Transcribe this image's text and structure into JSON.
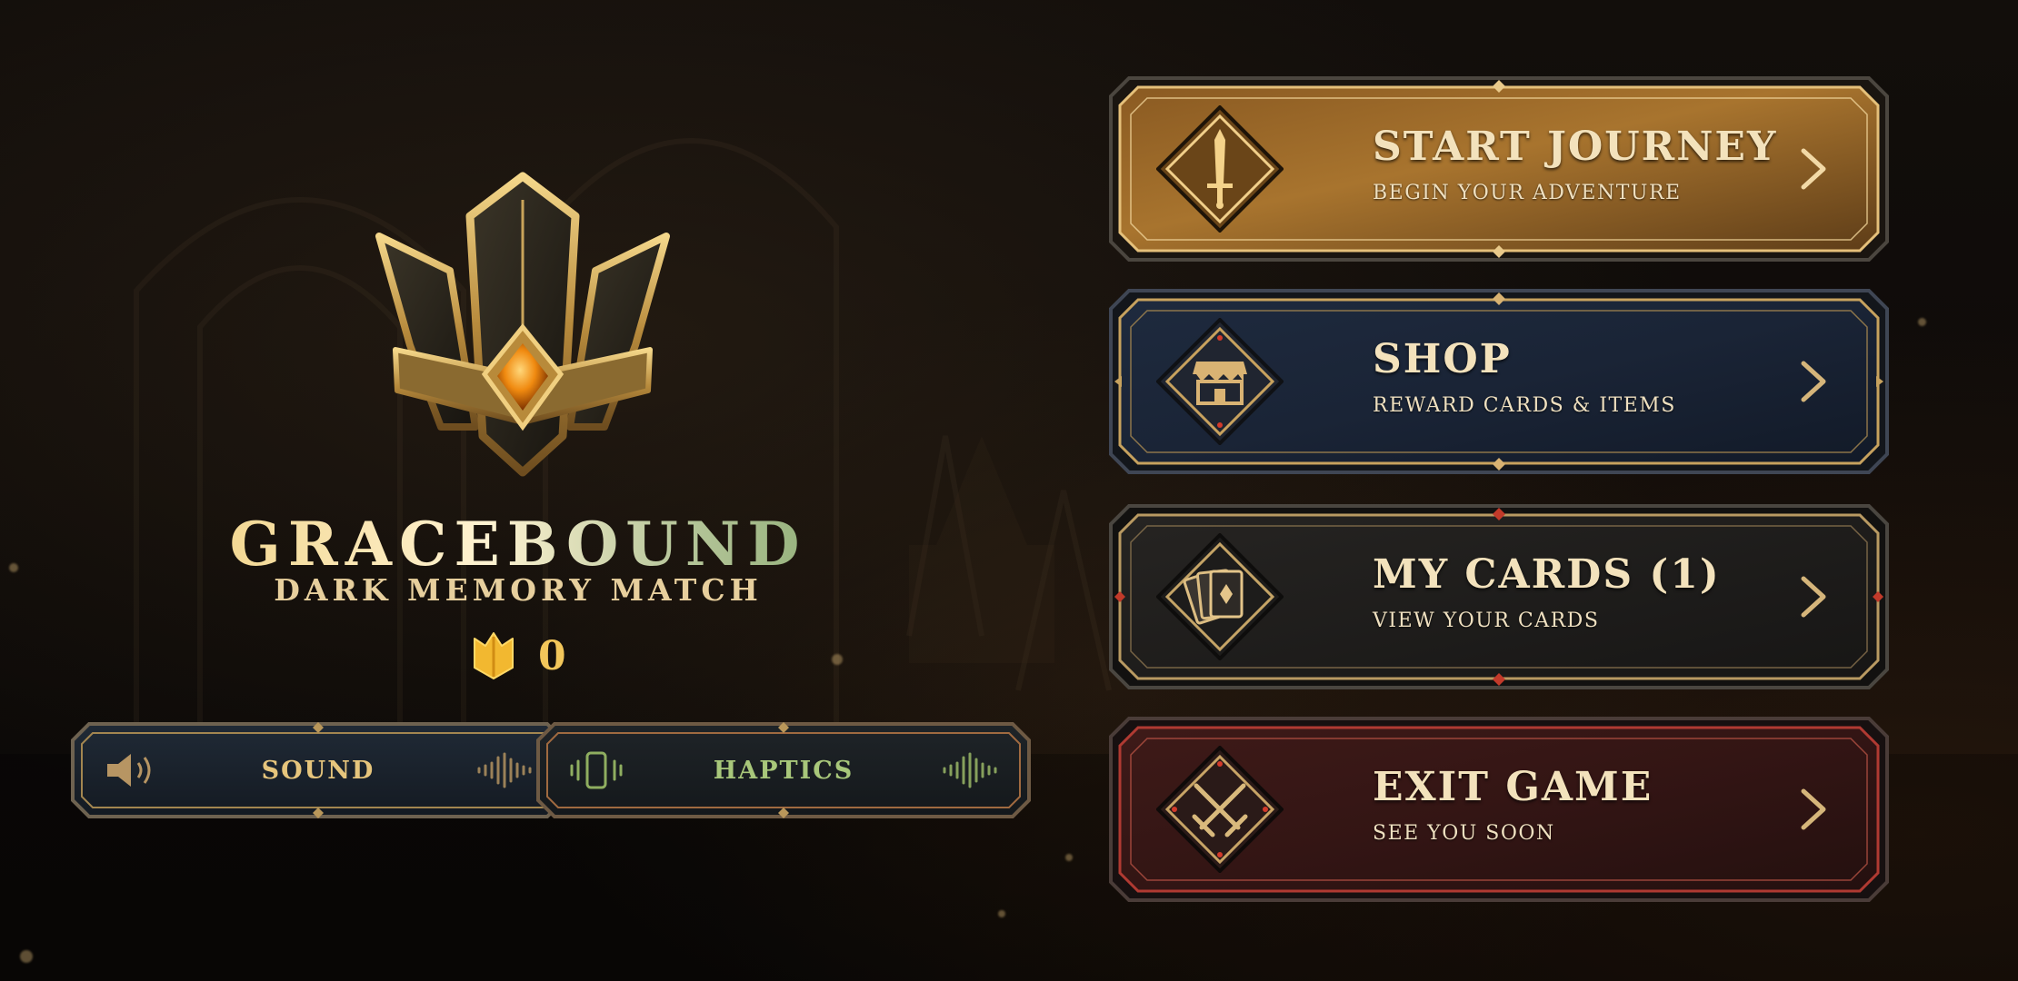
{
  "brand": {
    "title": "GRACEBOUND",
    "subtitle": "DARK MEMORY MATCH",
    "emblem_icon": "crown-emblem-icon"
  },
  "currency": {
    "icon": "crown-icon",
    "count": "0"
  },
  "settings": {
    "sound": {
      "label": "SOUND",
      "icon": "speaker-icon",
      "enabled": true
    },
    "haptics": {
      "label": "HAPTICS",
      "icon": "phone-vibrate-icon",
      "enabled": true
    }
  },
  "menu": {
    "start": {
      "title": "START JOURNEY",
      "subtitle": "BEGIN YOUR ADVENTURE",
      "icon": "sword-icon"
    },
    "shop": {
      "title": "SHOP",
      "subtitle": "REWARD CARDS & ITEMS",
      "icon": "shop-icon"
    },
    "cards": {
      "title": "MY CARDS (1)",
      "subtitle": "VIEW YOUR CARDS",
      "icon": "cards-icon"
    },
    "exit": {
      "title": "EXIT GAME",
      "subtitle": "SEE YOU SOON",
      "icon": "crossed-swords-icon"
    }
  },
  "colors": {
    "gold": "#d2a55a",
    "start_fill": "#7a4e1e",
    "shop_fill": "#1b2436",
    "cards_fill": "#1e1c1a",
    "exit_fill": "#3a1717",
    "sound_text": "#e6c57c",
    "haptics_text": "#a8c77a"
  }
}
